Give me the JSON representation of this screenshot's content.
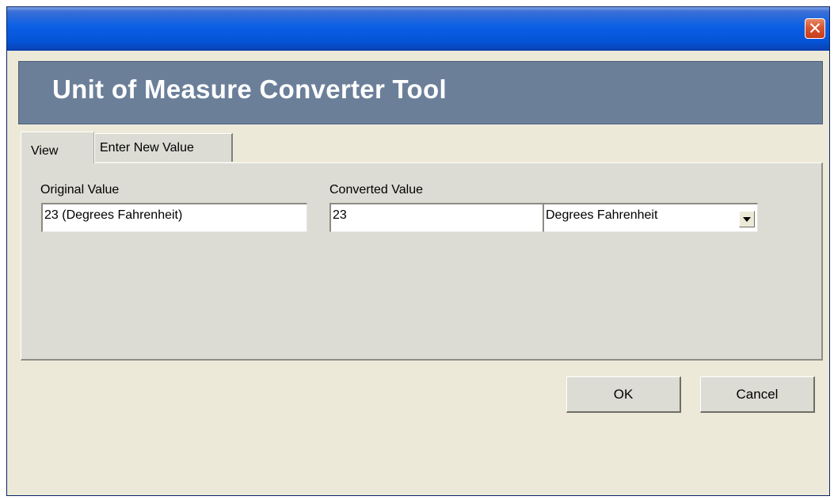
{
  "dialog": {
    "header_title": "Unit of Measure Converter Tool"
  },
  "tabs": [
    {
      "label": "View",
      "active": true
    },
    {
      "label": "Enter New Value",
      "active": false
    }
  ],
  "fields": {
    "original_label": "Original Value",
    "original_value": "23 (Degrees Fahrenheit)",
    "converted_label": "Converted Value",
    "converted_value": "23",
    "unit_selected": "Degrees Fahrenheit"
  },
  "buttons": {
    "ok_label": "OK",
    "cancel_label": "Cancel"
  },
  "colors": {
    "titlebar": "#0553d6",
    "close_button": "#d8552f",
    "header_band": "#6b7f99",
    "dialog_background": "#ece9d8"
  }
}
